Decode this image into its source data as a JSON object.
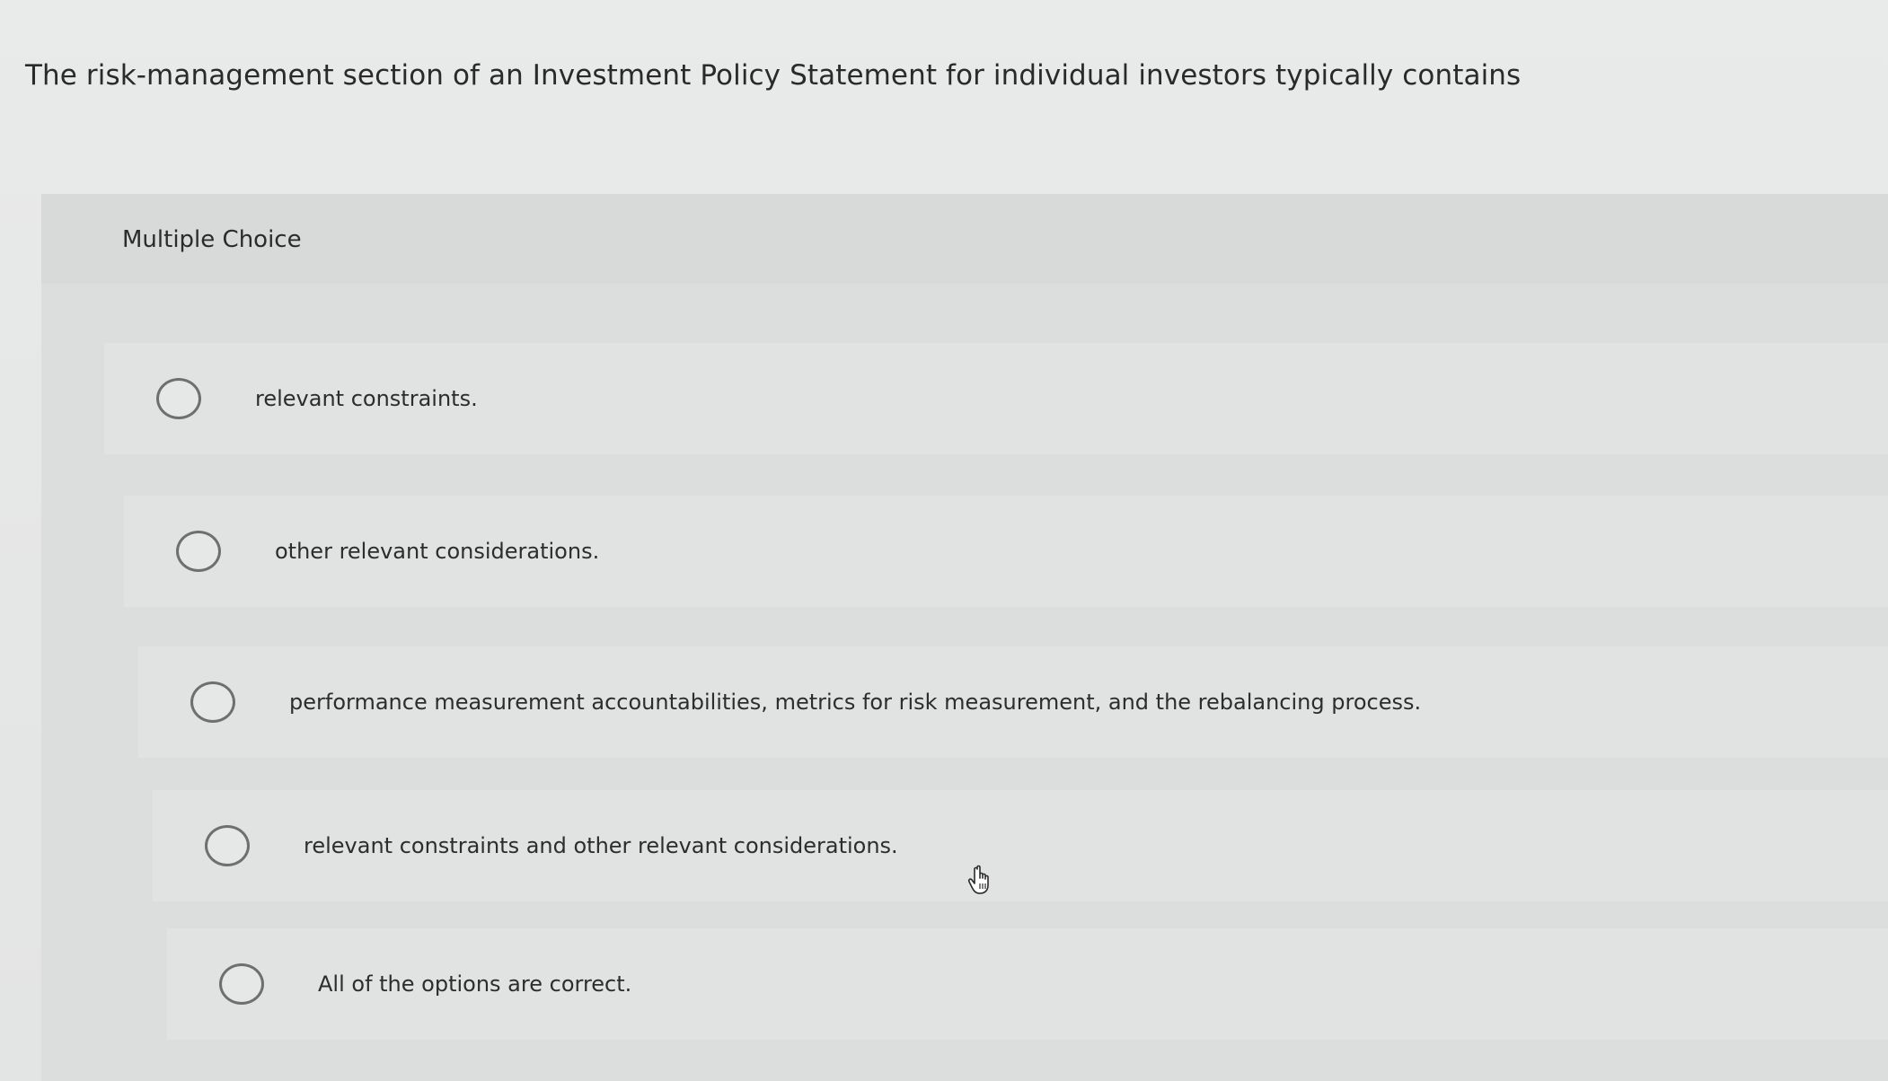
{
  "question": {
    "text": "The risk-management section of an Investment Policy Statement for individual investors typically contains"
  },
  "multiple_choice": {
    "label": "Multiple Choice",
    "options": [
      {
        "label": "relevant constraints.",
        "selected": false
      },
      {
        "label": "other relevant considerations.",
        "selected": false
      },
      {
        "label": "performance measurement accountabilities, metrics for risk measurement, and the rebalancing process.",
        "selected": false
      },
      {
        "label": "relevant constraints and other relevant considerations.",
        "selected": false
      },
      {
        "label": "All of the options are correct.",
        "selected": false
      }
    ]
  },
  "icons": {
    "cursor": "hand-pointer-icon",
    "radio": "radio-button-icon"
  },
  "colors": {
    "background": "#e6e7e7",
    "panel": "#dcdddd",
    "option_row": "#e1e2e2",
    "radio_border": "#6f6f6f",
    "text": "#2b2b2b"
  }
}
